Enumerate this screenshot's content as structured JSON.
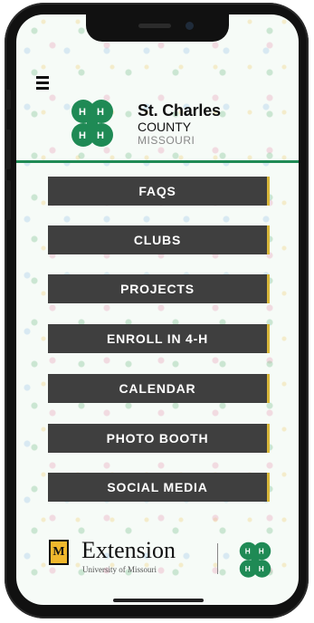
{
  "header": {
    "org_title": "St. Charles",
    "org_subtitle": "COUNTY",
    "org_state": "MISSOURI"
  },
  "nav": {
    "items": [
      {
        "label": "FAQS"
      },
      {
        "label": "CLUBS"
      },
      {
        "label": "PROJECTS"
      },
      {
        "label": "ENROLL IN 4-H"
      },
      {
        "label": "CALENDAR"
      },
      {
        "label": "PHOTO BOOTH"
      },
      {
        "label": "SOCIAL MEDIA"
      }
    ]
  },
  "footer": {
    "mu_letter": "M",
    "extension_word": "Extension",
    "extension_sub": "University of Missouri"
  },
  "colors": {
    "brand_green": "#1f8a55",
    "button_bg": "#3f3f3f",
    "accent_gold": "#d8b73a"
  },
  "icons": [
    "menu-icon",
    "clover-logo-icon",
    "mu-logo-icon",
    "clover-small-icon"
  ]
}
